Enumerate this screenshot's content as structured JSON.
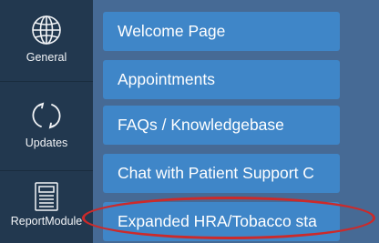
{
  "sidebar": {
    "items": [
      {
        "label": "General",
        "icon": "globe-icon"
      },
      {
        "label": "Updates",
        "icon": "refresh-icon"
      },
      {
        "label": "ReportModule",
        "icon": "report-icon"
      }
    ]
  },
  "menu": {
    "items": [
      {
        "label": "Welcome Page"
      },
      {
        "label": "Appointments"
      },
      {
        "label": "FAQs / Knowledgebase"
      },
      {
        "label": "Chat with Patient Support C"
      },
      {
        "label": "Expanded HRA/Tobacco sta"
      }
    ]
  },
  "colors": {
    "sidebar_bg": "#22384f",
    "panel_bg": "#466a95",
    "button_bg": "#3f86c8",
    "highlight_ring": "#cc2a2a"
  }
}
